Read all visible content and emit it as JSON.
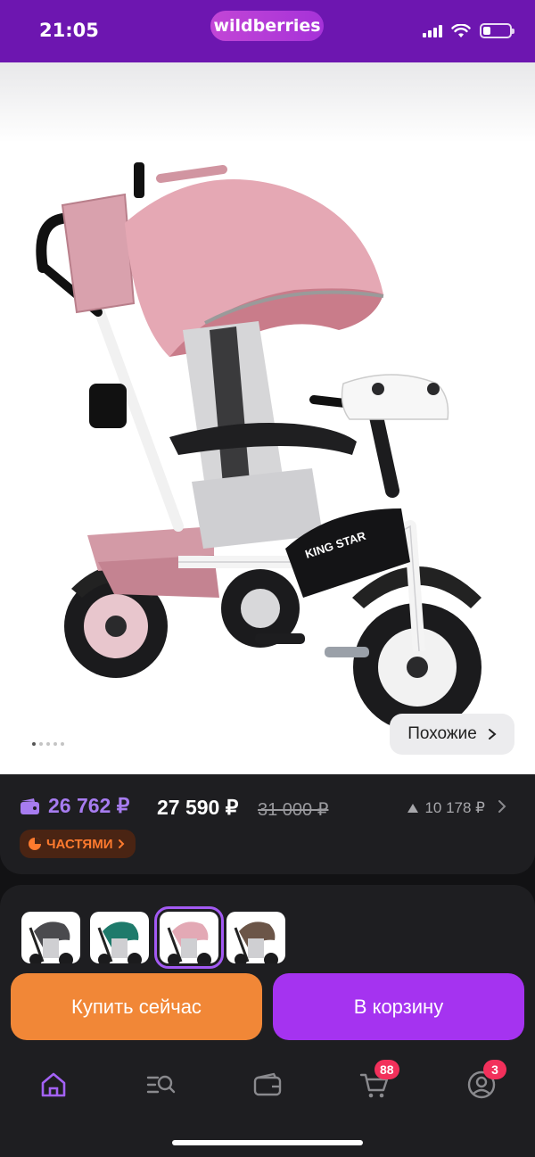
{
  "status_bar": {
    "time": "21:05",
    "app_badge": "wildberries",
    "battery_level": 0.3
  },
  "photo": {
    "back_icon": "back-chevron-icon",
    "favorite_icon": "heart-icon",
    "share_icon": "share-icon",
    "image_name": "tricycle-stroller-photo",
    "brand_print": "KING STAR",
    "carousel": {
      "count": 5,
      "active_index": 0
    },
    "similar_label": "Похожие"
  },
  "price": {
    "wallet_price": "26 762 ₽",
    "price": "27 590 ₽",
    "old_price": "31 000 ₽",
    "price_drop": "10 178 ₽",
    "installments_label": "ЧАСТЯМИ"
  },
  "variants": [
    {
      "name": "variant-gray",
      "hood_color": "#4a4a4e",
      "selected": false
    },
    {
      "name": "variant-teal",
      "hood_color": "#1e7a6b",
      "selected": false
    },
    {
      "name": "variant-pink",
      "hood_color": "#e3a9b5",
      "selected": true
    },
    {
      "name": "variant-brown",
      "hood_color": "#6b5548",
      "selected": false
    }
  ],
  "actions": {
    "buy_now": "Купить сейчас",
    "add_to_cart": "В корзину"
  },
  "tabbar": {
    "items": [
      {
        "name": "home",
        "icon": "home-icon",
        "active": true
      },
      {
        "name": "catalog",
        "icon": "catalog-search-icon",
        "active": false
      },
      {
        "name": "wallet",
        "icon": "wallet-icon",
        "active": false
      },
      {
        "name": "cart",
        "icon": "cart-icon",
        "badge": "88",
        "active": false
      },
      {
        "name": "profile",
        "icon": "profile-icon",
        "badge": "3",
        "active": false
      }
    ]
  },
  "colors": {
    "brand": "#6d16b0",
    "accent_purple": "#a533f0",
    "accent_orange": "#f18737",
    "badge": "#f2305b"
  }
}
